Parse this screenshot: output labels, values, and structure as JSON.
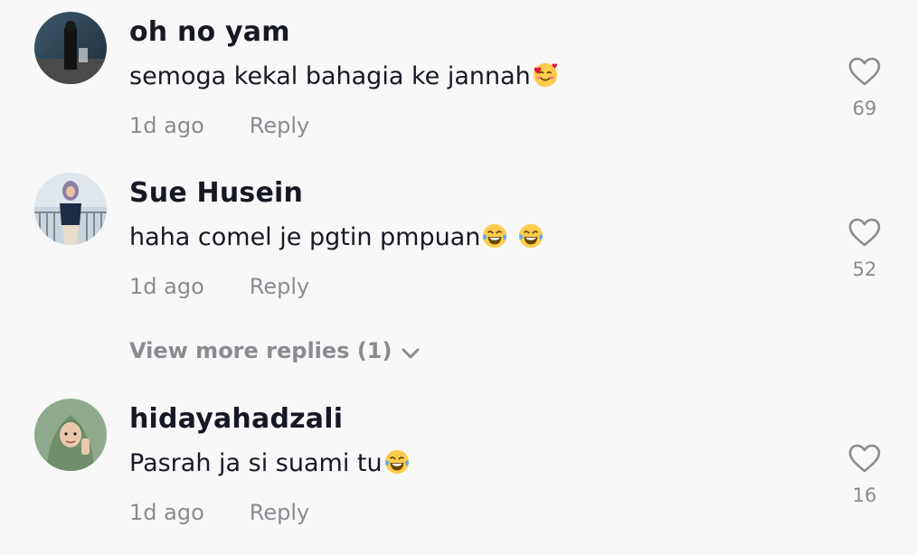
{
  "comments": [
    {
      "username": "oh no yam",
      "text": "semoga kekal bahagia ke jannah",
      "emoji": "smiling-face-with-hearts",
      "time": "1d ago",
      "reply_label": "Reply",
      "likes": "69"
    },
    {
      "username": "Sue Husein",
      "text": "haha comel je pgtin pmpuan",
      "emoji": "face-with-tears-of-joy",
      "time": "1d ago",
      "reply_label": "Reply",
      "likes": "52"
    },
    {
      "username": "hidayahadzali",
      "text": "Pasrah ja si suami tu",
      "emoji": "face-with-tears-of-joy",
      "time": "1d ago",
      "reply_label": "Reply",
      "likes": "16"
    }
  ],
  "view_more_replies": "View more replies (1)",
  "colors": {
    "background": "#f8f8f8",
    "primary_text": "#161823",
    "secondary_text": "#8a8b91"
  },
  "icons": [
    "heart-icon",
    "chevron-down-icon"
  ]
}
